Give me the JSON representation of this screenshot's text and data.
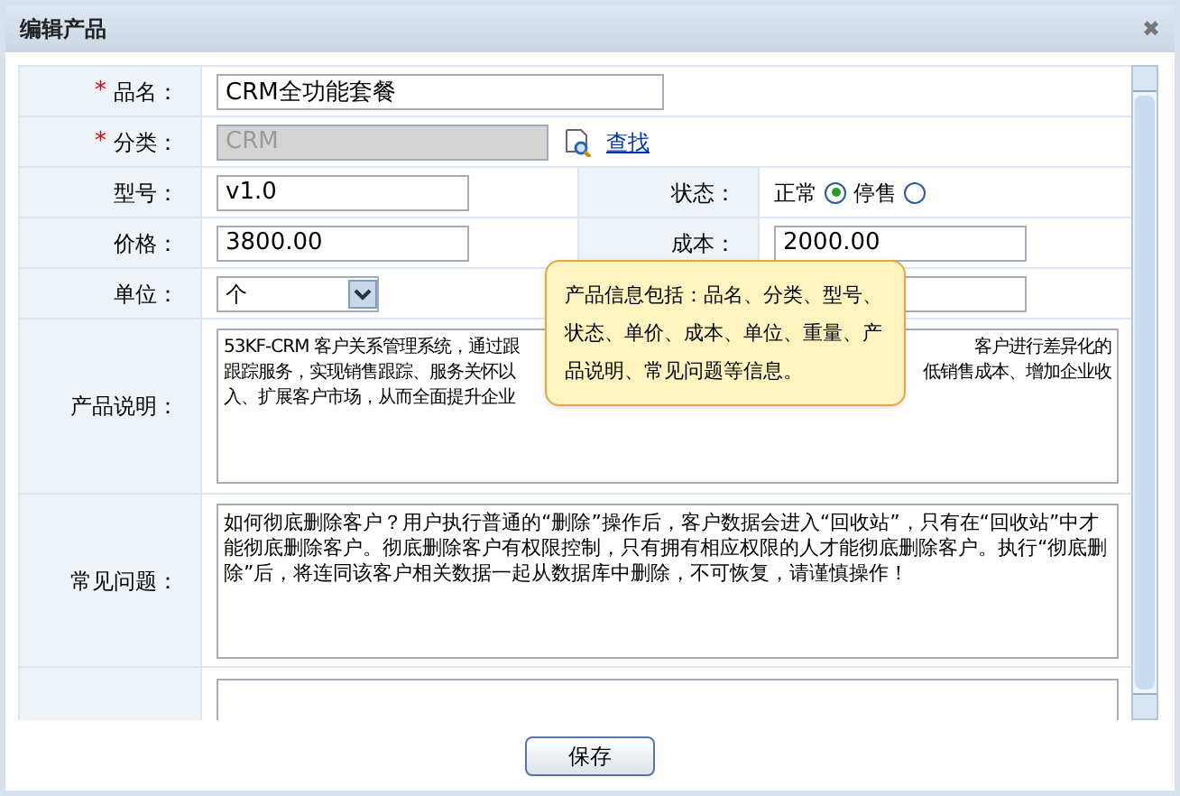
{
  "window": {
    "title": "编辑产品",
    "close": "✖"
  },
  "fields": {
    "name": {
      "label": "品名：",
      "required": true,
      "value": "CRM全功能套餐"
    },
    "category": {
      "label": "分类：",
      "required": true,
      "value": "CRM",
      "disabled": true,
      "link": "查找"
    },
    "model": {
      "label": "型号：",
      "value": "v1.0"
    },
    "status": {
      "label": "状态：",
      "options": [
        {
          "label": "正常",
          "selected": true
        },
        {
          "label": "停售",
          "selected": false
        }
      ]
    },
    "price": {
      "label": "价格：",
      "value": "3800.00"
    },
    "cost": {
      "label": "成本：",
      "value": "2000.00"
    },
    "unit": {
      "label": "单位：",
      "value": "个"
    },
    "description": {
      "label": "产品说明：",
      "lines": [
        {
          "left": "53KF-CRM 客户关系管理系统，通过跟",
          "right": "客户进行差异化的"
        },
        {
          "left": "跟踪服务，实现销售跟踪、服务关怀以",
          "right": "低销售成本、增加企业收"
        },
        {
          "left": "入、扩展客户市场，从而全面提升企业"
        }
      ]
    },
    "faq": {
      "label": "常见问题：",
      "value": "如何彻底删除客户？用户执行普通的“删除”操作后，客户数据会进入“回收站”，只有在“回收站”中才能彻底删除客户。彻底删除客户有权限控制，只有拥有相应权限的人才能彻底删除客户。执行“彻底删除”后，将连同该客户相关数据一起从数据库中删除，不可恢复，请谨慎操作！"
    }
  },
  "tooltip": "产品信息包括：品名、分类、型号、状态、单价、成本、单位、重量、产品说明、常见问题等信息。",
  "save_button": "保存",
  "required_mark": "*"
}
